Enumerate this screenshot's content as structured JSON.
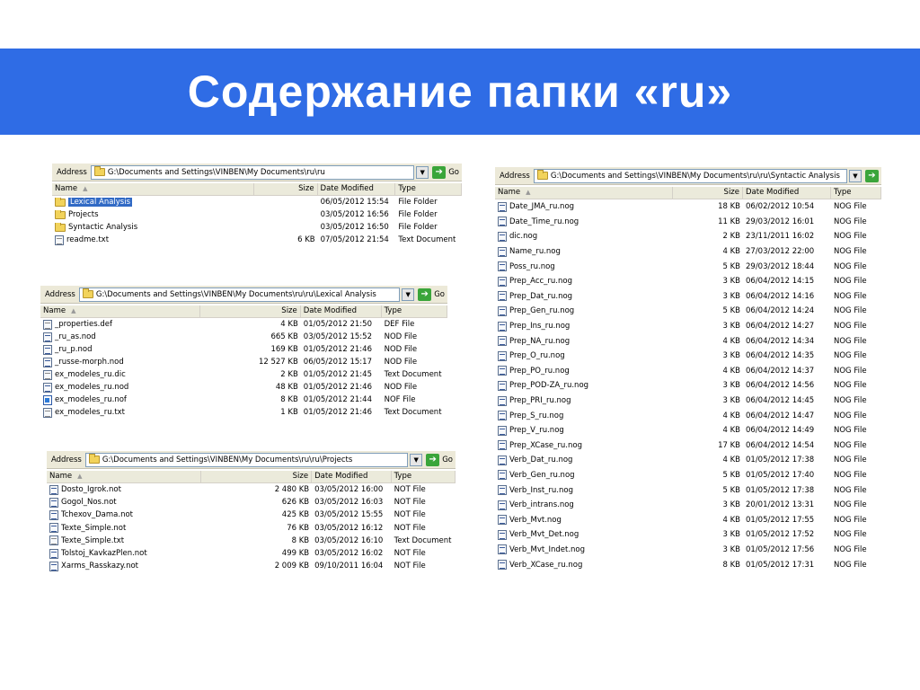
{
  "slide_title": "Содержание папки «ru»",
  "icons": {
    "folder": "folder-icon",
    "data_file": "data-file-icon",
    "text_file": "text-document-icon",
    "go": "go-arrow-icon",
    "dropdown": "dropdown-arrow-icon"
  },
  "colors": {
    "title_band": "#2f6ce5",
    "selection": "#316ac5"
  },
  "windows": [
    {
      "id": "ru",
      "address_label": "Address",
      "address_path": "G:\\Documents and Settings\\VINBEN\\My Documents\\ru\\ru",
      "go_label": "Go",
      "columns": [
        "Name",
        "Size",
        "Date Modified",
        "Type"
      ],
      "rows": [
        {
          "icon": "folder",
          "name": "Lexical Analysis",
          "size": "",
          "date": "06/05/2012 15:54",
          "type": "File Folder",
          "selected": true
        },
        {
          "icon": "folder",
          "name": "Projects",
          "size": "",
          "date": "03/05/2012 16:56",
          "type": "File Folder"
        },
        {
          "icon": "folder",
          "name": "Syntactic Analysis",
          "size": "",
          "date": "03/05/2012 16:50",
          "type": "File Folder"
        },
        {
          "icon": "txt",
          "name": "readme.txt",
          "size": "6 KB",
          "date": "07/05/2012 21:54",
          "type": "Text Document"
        }
      ]
    },
    {
      "id": "lexical",
      "address_label": "Address",
      "address_path": "G:\\Documents and Settings\\VINBEN\\My Documents\\ru\\ru\\Lexical Analysis",
      "go_label": "Go",
      "columns": [
        "Name",
        "Size",
        "Date Modified",
        "Type"
      ],
      "rows": [
        {
          "icon": "txt",
          "name": "_properties.def",
          "size": "4 KB",
          "date": "01/05/2012 21:50",
          "type": "DEF File"
        },
        {
          "icon": "dat",
          "name": "_ru_as.nod",
          "size": "665 KB",
          "date": "03/05/2012 15:52",
          "type": "NOD File"
        },
        {
          "icon": "dat",
          "name": "_ru_p.nod",
          "size": "169 KB",
          "date": "01/05/2012 21:46",
          "type": "NOD File"
        },
        {
          "icon": "dat",
          "name": "_russe-morph.nod",
          "size": "12 527 KB",
          "date": "06/05/2012 15:17",
          "type": "NOD File"
        },
        {
          "icon": "txt",
          "name": "ex_modeles_ru.dic",
          "size": "2 KB",
          "date": "01/05/2012 21:45",
          "type": "Text Document"
        },
        {
          "icon": "dat",
          "name": "ex_modeles_ru.nod",
          "size": "48 KB",
          "date": "01/05/2012 21:46",
          "type": "NOD File"
        },
        {
          "icon": "nof",
          "name": "ex_modeles_ru.nof",
          "size": "8 KB",
          "date": "01/05/2012 21:44",
          "type": "NOF File"
        },
        {
          "icon": "txt",
          "name": "ex_modeles_ru.txt",
          "size": "1 KB",
          "date": "01/05/2012 21:46",
          "type": "Text Document"
        }
      ]
    },
    {
      "id": "projects",
      "address_label": "Address",
      "address_path": "G:\\Documents and Settings\\VINBEN\\My Documents\\ru\\ru\\Projects",
      "go_label": "Go",
      "columns": [
        "Name",
        "Size",
        "Date Modified",
        "Type"
      ],
      "rows": [
        {
          "icon": "dat",
          "name": "Dosto_Igrok.not",
          "size": "2 480 KB",
          "date": "03/05/2012 16:00",
          "type": "NOT File"
        },
        {
          "icon": "dat",
          "name": "Gogol_Nos.not",
          "size": "626 KB",
          "date": "03/05/2012 16:03",
          "type": "NOT File"
        },
        {
          "icon": "dat",
          "name": "Tchexov_Dama.not",
          "size": "425 KB",
          "date": "03/05/2012 15:55",
          "type": "NOT File"
        },
        {
          "icon": "dat",
          "name": "Texte_Simple.not",
          "size": "76 KB",
          "date": "03/05/2012 16:12",
          "type": "NOT File"
        },
        {
          "icon": "txt",
          "name": "Texte_Simple.txt",
          "size": "8 KB",
          "date": "03/05/2012 16:10",
          "type": "Text Document"
        },
        {
          "icon": "dat",
          "name": "Tolstoj_KavkazPlen.not",
          "size": "499 KB",
          "date": "03/05/2012 16:02",
          "type": "NOT File"
        },
        {
          "icon": "dat",
          "name": "Xarms_Rasskazy.not",
          "size": "2 009 KB",
          "date": "09/10/2011 16:04",
          "type": "NOT File"
        }
      ]
    },
    {
      "id": "syntactic",
      "address_label": "Address",
      "address_path": "G:\\Documents and Settings\\VINBEN\\My Documents\\ru\\ru\\Syntactic Analysis",
      "go_label": "",
      "columns": [
        "Name",
        "Size",
        "Date Modified",
        "Type"
      ],
      "rows": [
        {
          "icon": "dat",
          "name": "Date_JMA_ru.nog",
          "size": "18 KB",
          "date": "06/02/2012 10:54",
          "type": "NOG File"
        },
        {
          "icon": "dat",
          "name": "Date_Time_ru.nog",
          "size": "11 KB",
          "date": "29/03/2012 16:01",
          "type": "NOG File"
        },
        {
          "icon": "dat",
          "name": "dic.nog",
          "size": "2 KB",
          "date": "23/11/2011 16:02",
          "type": "NOG File"
        },
        {
          "icon": "dat",
          "name": "Name_ru.nog",
          "size": "4 KB",
          "date": "27/03/2012 22:00",
          "type": "NOG File"
        },
        {
          "icon": "dat",
          "name": "Poss_ru.nog",
          "size": "5 KB",
          "date": "29/03/2012 18:44",
          "type": "NOG File"
        },
        {
          "icon": "dat",
          "name": "Prep_Acc_ru.nog",
          "size": "3 KB",
          "date": "06/04/2012 14:15",
          "type": "NOG File"
        },
        {
          "icon": "dat",
          "name": "Prep_Dat_ru.nog",
          "size": "3 KB",
          "date": "06/04/2012 14:16",
          "type": "NOG File"
        },
        {
          "icon": "dat",
          "name": "Prep_Gen_ru.nog",
          "size": "5 KB",
          "date": "06/04/2012 14:24",
          "type": "NOG File"
        },
        {
          "icon": "dat",
          "name": "Prep_Ins_ru.nog",
          "size": "3 KB",
          "date": "06/04/2012 14:27",
          "type": "NOG File"
        },
        {
          "icon": "dat",
          "name": "Prep_NA_ru.nog",
          "size": "4 KB",
          "date": "06/04/2012 14:34",
          "type": "NOG File"
        },
        {
          "icon": "dat",
          "name": "Prep_O_ru.nog",
          "size": "3 KB",
          "date": "06/04/2012 14:35",
          "type": "NOG File"
        },
        {
          "icon": "dat",
          "name": "Prep_PO_ru.nog",
          "size": "4 KB",
          "date": "06/04/2012 14:37",
          "type": "NOG File"
        },
        {
          "icon": "dat",
          "name": "Prep_POD-ZA_ru.nog",
          "size": "3 KB",
          "date": "06/04/2012 14:56",
          "type": "NOG File"
        },
        {
          "icon": "dat",
          "name": "Prep_PRI_ru.nog",
          "size": "3 KB",
          "date": "06/04/2012 14:45",
          "type": "NOG File"
        },
        {
          "icon": "dat",
          "name": "Prep_S_ru.nog",
          "size": "4 KB",
          "date": "06/04/2012 14:47",
          "type": "NOG File"
        },
        {
          "icon": "dat",
          "name": "Prep_V_ru.nog",
          "size": "4 KB",
          "date": "06/04/2012 14:49",
          "type": "NOG File"
        },
        {
          "icon": "dat",
          "name": "Prep_XCase_ru.nog",
          "size": "17 KB",
          "date": "06/04/2012 14:54",
          "type": "NOG File"
        },
        {
          "icon": "dat",
          "name": "Verb_Dat_ru.nog",
          "size": "4 KB",
          "date": "01/05/2012 17:38",
          "type": "NOG File"
        },
        {
          "icon": "dat",
          "name": "Verb_Gen_ru.nog",
          "size": "5 KB",
          "date": "01/05/2012 17:40",
          "type": "NOG File"
        },
        {
          "icon": "dat",
          "name": "Verb_Inst_ru.nog",
          "size": "5 KB",
          "date": "01/05/2012 17:38",
          "type": "NOG File"
        },
        {
          "icon": "dat",
          "name": "Verb_intrans.nog",
          "size": "3 KB",
          "date": "20/01/2012 13:31",
          "type": "NOG File"
        },
        {
          "icon": "dat",
          "name": "Verb_Mvt.nog",
          "size": "4 KB",
          "date": "01/05/2012 17:55",
          "type": "NOG File"
        },
        {
          "icon": "dat",
          "name": "Verb_Mvt_Det.nog",
          "size": "3 KB",
          "date": "01/05/2012 17:52",
          "type": "NOG File"
        },
        {
          "icon": "dat",
          "name": "Verb_Mvt_Indet.nog",
          "size": "3 KB",
          "date": "01/05/2012 17:56",
          "type": "NOG File"
        },
        {
          "icon": "dat",
          "name": "Verb_XCase_ru.nog",
          "size": "8 KB",
          "date": "01/05/2012 17:31",
          "type": "NOG File"
        }
      ]
    }
  ]
}
